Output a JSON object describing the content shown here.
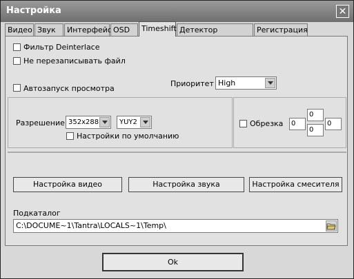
{
  "window": {
    "title": "Настройка",
    "close_symbol": "✕"
  },
  "tabs": [
    {
      "label": "Видео"
    },
    {
      "label": "Звук"
    },
    {
      "label": "Интерфейс"
    },
    {
      "label": "OSD"
    },
    {
      "label": "Timeshift",
      "active": true
    },
    {
      "label": "Детектор движения"
    },
    {
      "label": "Регистрация"
    }
  ],
  "options": {
    "deinterlace_label": "Фильтр Deinterlace",
    "no_overwrite_label": "Не перезаписывать файл",
    "autostart_label": "Автозапуск просмотра",
    "priority_label": "Приоритет",
    "priority_value": "High"
  },
  "resolution": {
    "label": "Разрешение",
    "size_value": "352x288",
    "format_value": "YUY2",
    "defaults_label": "Настройки по умолчанию"
  },
  "crop": {
    "label": "Обрезка",
    "left": "0",
    "top": "0",
    "bottom": "0",
    "right": "0"
  },
  "buttons": {
    "video_settings": "Настройка видео",
    "audio_settings": "Настройка звука",
    "mixer_settings": "Настройка смесителя"
  },
  "subdir": {
    "label": "Подкаталог",
    "value": "C:\\DOCUME~1\\Tantra\\LOCALS~1\\Temp\\"
  },
  "ok_label": "Ok",
  "icons": {
    "browse": "folder-open-icon",
    "dropdown": "chevron-down-icon"
  }
}
